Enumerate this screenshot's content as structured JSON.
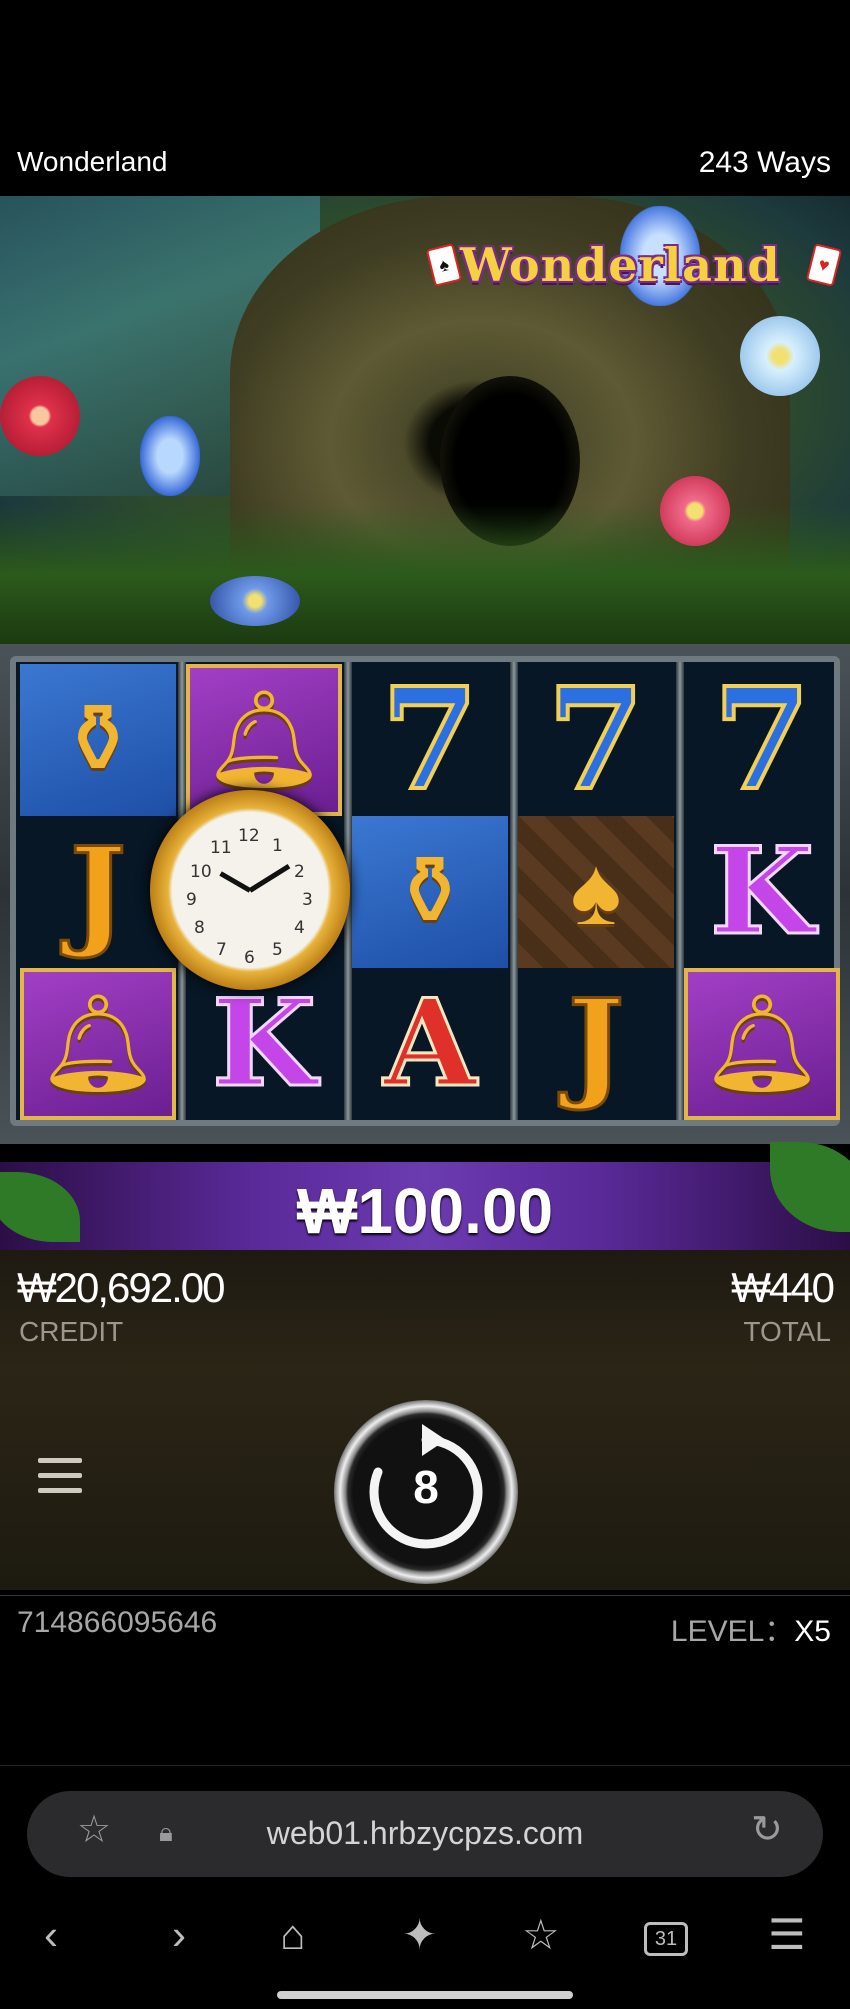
{
  "header": {
    "game_title": "Wonderland",
    "ways": "243 Ways"
  },
  "logo": {
    "text": "Wonderland"
  },
  "reels": {
    "rows": [
      [
        "vase",
        "bell",
        "7",
        "7",
        "7"
      ],
      [
        "J",
        "clock",
        "vase",
        "spade",
        "K"
      ],
      [
        "bell",
        "K",
        "A",
        "J",
        "bell"
      ]
    ],
    "overlay_symbol": "clock"
  },
  "win": {
    "amount": "₩100.00"
  },
  "balance": {
    "credit_value": "₩20,692.00",
    "credit_label": "CREDIT",
    "total_value": "₩440",
    "total_label": "TOTAL"
  },
  "controls": {
    "auto_spin_count": "8",
    "menu_icon": "hamburger-icon",
    "spin_icon": "refresh-icon"
  },
  "status": {
    "round_id": "714866095646",
    "level_label": "LEVEL：",
    "level_value": "X5"
  },
  "browser": {
    "url": "web01.hrbzycpzs.com",
    "tab_count": "31"
  },
  "colors": {
    "win_bar": "#5a2a9a",
    "reel_background": "#071726",
    "gold": "#f2b531"
  }
}
